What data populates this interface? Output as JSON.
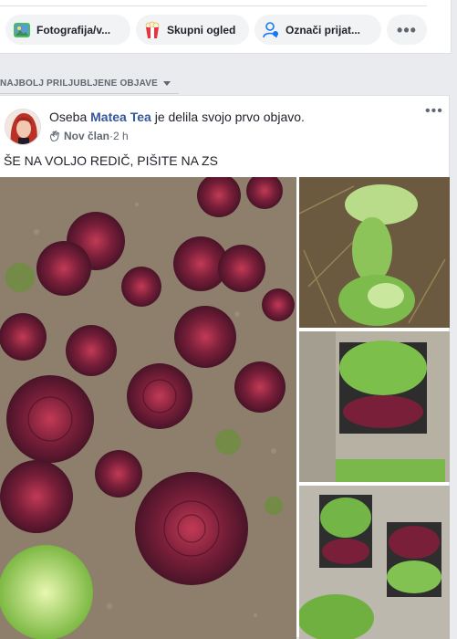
{
  "composer": {
    "photo_video": "Fotografija/v...",
    "group_view": "Skupni ogled",
    "tag_friends": "Označi prijat...",
    "more": "•••"
  },
  "feed": {
    "sort_label": "NAJBOLJ PRILJUBLJENE OBJAVE"
  },
  "post": {
    "prefix": "Oseba ",
    "author": "Matea Tea",
    "suffix": " je delila svojo prvo objavo.",
    "badge": "Nov član",
    "separator": " · ",
    "time": "2 h",
    "menu": "•••",
    "text": "ŠE NA VOLJO REDIČ, PIŠITE NA ZS"
  },
  "colors": {
    "link": "#365899",
    "radicchio": "#7a1f3a",
    "lettuce": "#8cc04a"
  }
}
